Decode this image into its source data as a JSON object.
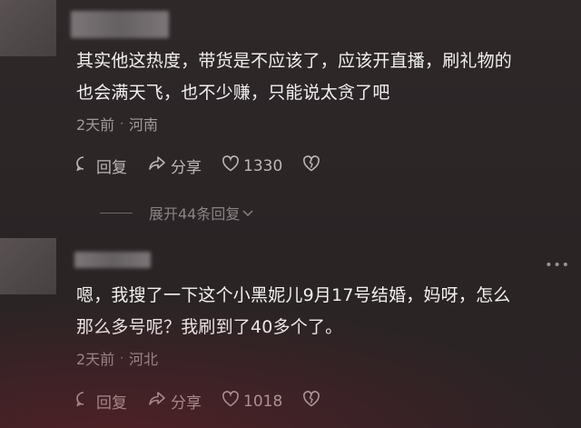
{
  "comments": [
    {
      "text_line1": "其实他这热度，带货是不应该了，应该开直播，刷礼物的",
      "text_line2": "也会满天飞，也不少赚，只能说太贪了吧",
      "time": "2天前",
      "separator": "·",
      "location": "河南",
      "reply_label": "回复",
      "share_label": "分享",
      "like_count": "1330",
      "expand_label": "展开44条回复"
    },
    {
      "text_line1": "嗯，我搜了一下这个小黑妮儿9月17号结婚，妈呀，怎么",
      "text_line2": "那么多号呢？我刷到了40多个了。",
      "time": "2天前",
      "separator": "·",
      "location": "河北",
      "reply_label": "回复",
      "share_label": "分享",
      "like_count": "1018",
      "more": "•••"
    }
  ]
}
